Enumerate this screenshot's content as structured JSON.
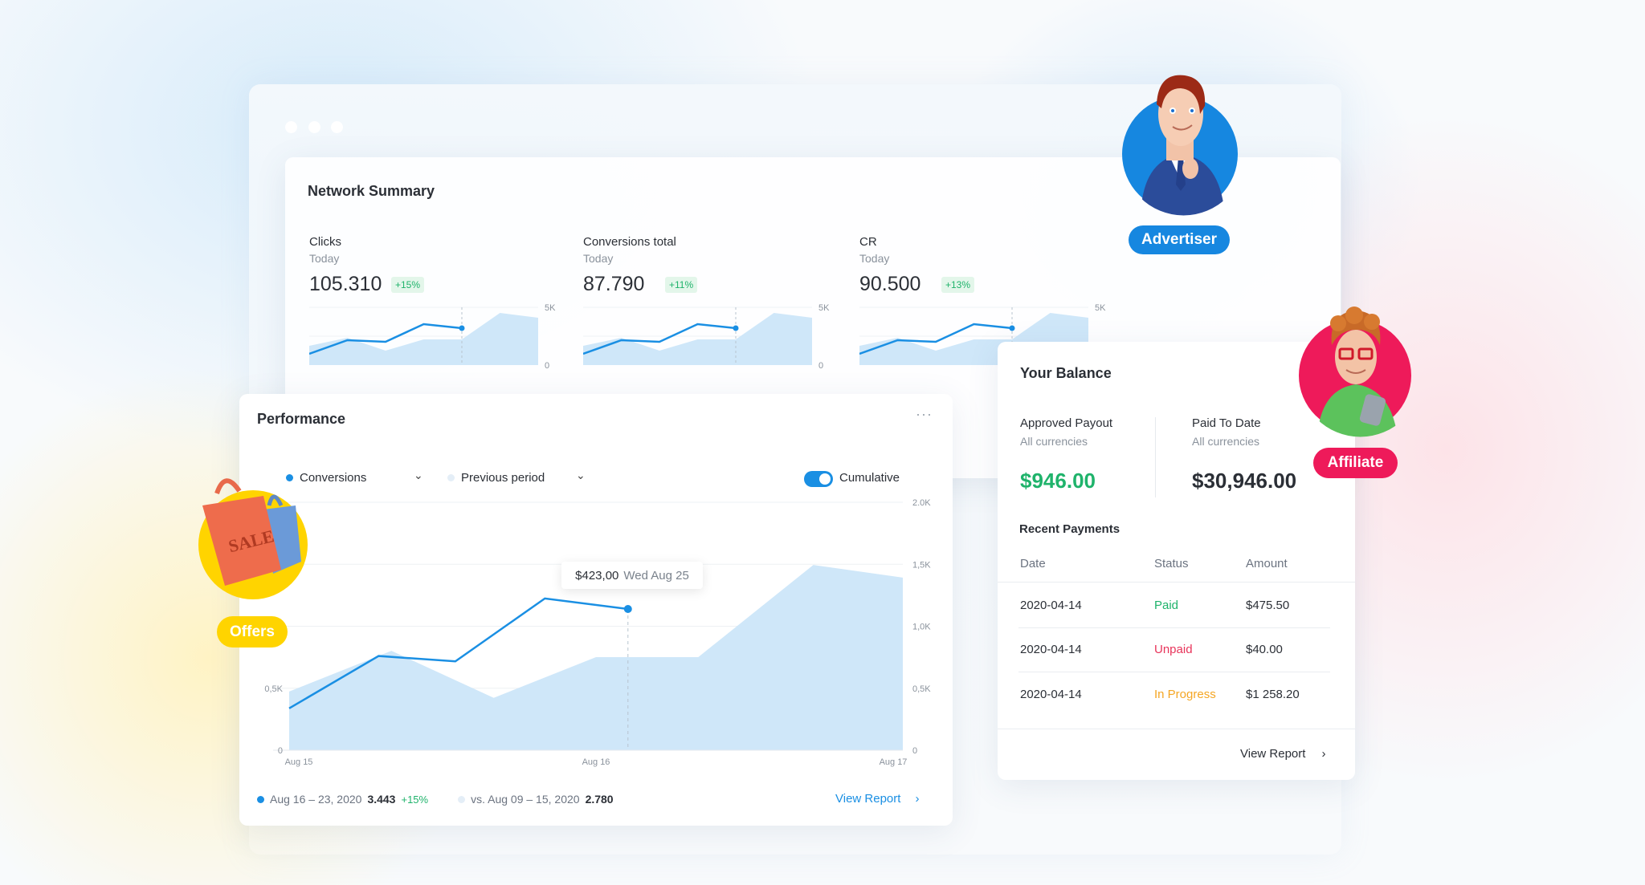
{
  "network_summary": {
    "title": "Network Summary",
    "metrics": [
      {
        "label": "Clicks",
        "period": "Today",
        "value": "105.310",
        "change": "+15%"
      },
      {
        "label": "Conversions total",
        "period": "Today",
        "value": "87.790",
        "change": "+11%"
      },
      {
        "label": "CR",
        "period": "Today",
        "value": "90.500",
        "change": "+13%"
      }
    ],
    "sparkline_ticks": [
      "5K",
      "0"
    ]
  },
  "performance": {
    "title": "Performance",
    "more_icon": "ellipsis-icon",
    "metric_select": "Conversions",
    "compare_select": "Previous period",
    "cumulative_label": "Cumulative",
    "cumulative_on": true,
    "tooltip": {
      "value": "$423,00",
      "date": "Wed Aug 25"
    },
    "footer": {
      "current_range": "Aug 16 – 23, 2020",
      "current_value": "3.443",
      "current_change": "+15%",
      "previous_range": "vs. Aug 09 – 15, 2020",
      "previous_value": "2.780",
      "view_report": "View Report"
    }
  },
  "balance": {
    "title": "Your Balance",
    "approved": {
      "label": "Approved Payout",
      "sub": "All currencies",
      "value": "$946.00"
    },
    "paid": {
      "label": "Paid To Date",
      "sub": "All currencies",
      "value": "$30,946.00"
    },
    "recent_title": "Recent Payments",
    "columns": [
      "Date",
      "Status",
      "Amount"
    ],
    "rows": [
      {
        "date": "2020-04-14",
        "status": "Paid",
        "status_color": "#1fb36b",
        "amount": "$475.50"
      },
      {
        "date": "2020-04-14",
        "status": "Unpaid",
        "status_color": "#e8345a",
        "amount": "$40.00"
      },
      {
        "date": "2020-04-14",
        "status": "In Progress",
        "status_color": "#f5a623",
        "amount": "$1 258.20"
      }
    ],
    "view_report": "View Report"
  },
  "roles": {
    "advertiser": "Advertiser",
    "affiliate": "Affiliate",
    "offers": "Offers",
    "bag_text": "SALE"
  },
  "colors": {
    "accent": "#1a8fe3",
    "area": "#cfe7f9",
    "positive": "#1fb36b",
    "negative": "#e8345a",
    "warning": "#f5a623",
    "affiliate": "#ee1a5a",
    "offers": "#ffd400"
  },
  "chart_data": [
    {
      "type": "line",
      "series": [
        {
          "kind": "area",
          "values": [
            1667,
            2361,
            1250,
            2222,
            2222,
            4514,
            4097
          ]
        },
        {
          "kind": "line",
          "values": [
            972,
            2153,
            2014,
            3542,
            3194
          ]
        }
      ],
      "ylim": [
        0,
        5000
      ],
      "yticks": [
        "5K",
        "0"
      ],
      "grid": true
    },
    {
      "type": "line",
      "xlabel": "",
      "ylabel": "",
      "xticks": [
        "Aug 15",
        "Aug 16",
        "Aug 17"
      ],
      "yticks_right": [
        "2.0K",
        "1,5K",
        "1,0K",
        "0,5K",
        "0"
      ],
      "yticks_left": [
        "0,5K",
        "0"
      ],
      "ylim": [
        0,
        2000
      ],
      "grid": true,
      "series": [
        {
          "name": "Conversions",
          "kind": "line",
          "color": "#1a8fe3",
          "x": [
            "2020-08-15T00:00",
            "2020-08-15T07:00",
            "2020-08-15T13:00",
            "2020-08-15T20:00",
            "2020-08-16T02:30"
          ],
          "values": [
            338,
            760,
            717,
            1224,
            1139
          ]
        },
        {
          "name": "Previous period",
          "kind": "area",
          "color": "#cfe7f9",
          "x": [
            "2020-08-15T00:00",
            "2020-08-15T08:00",
            "2020-08-15T16:00",
            "2020-08-16T00:00",
            "2020-08-16T08:00",
            "2020-08-16T17:00",
            "2020-08-17T00:00"
          ],
          "values": [
            473,
            802,
            422,
            751,
            751,
            1494,
            1392
          ]
        }
      ],
      "highlight": {
        "x": "2020-08-16T02:30",
        "label": "$423,00 Wed Aug 25"
      }
    }
  ]
}
